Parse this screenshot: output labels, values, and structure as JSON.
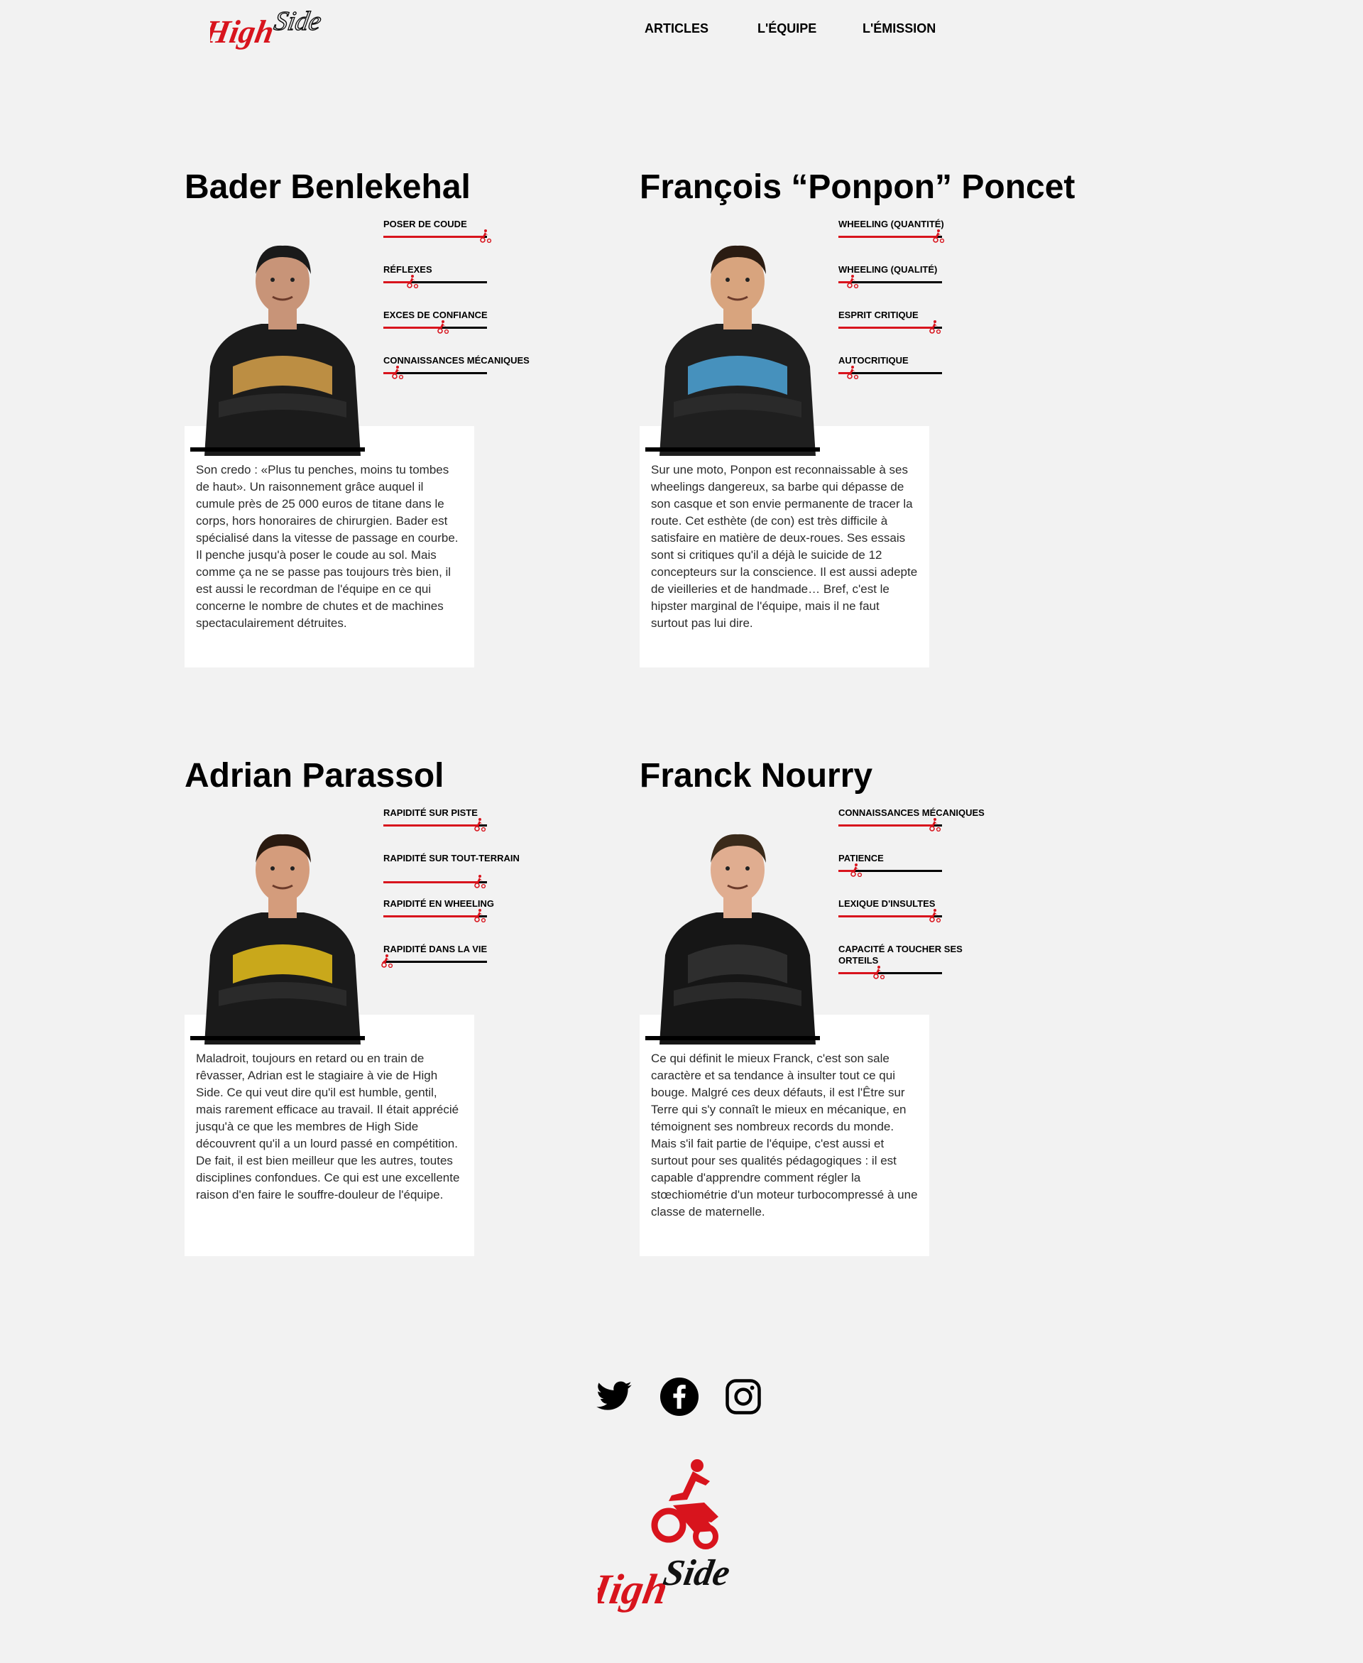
{
  "header": {
    "logo_text": "HighSide",
    "nav": [
      {
        "label": "ARTICLES"
      },
      {
        "label": "L'ÉQUIPE"
      },
      {
        "label": "L'ÉMISSION"
      }
    ]
  },
  "team": [
    {
      "name": "Bader Benlekehal",
      "skills": [
        {
          "label": "POSER DE COUDE",
          "level": 0.97
        },
        {
          "label": "RÉFLEXES",
          "level": 0.27
        },
        {
          "label": "EXCES DE CONFIANCE",
          "level": 0.56
        },
        {
          "label": "CONNAISSANCES MÉCANIQUES",
          "level": 0.12
        }
      ],
      "bio": "Son credo : «Plus tu penches, moins tu tombes de haut». Un raisonnement grâce auquel il cumule près de 25 000 euros de titane dans le corps, hors honoraires de chirurgien. Bader est spécialisé dans la vitesse de passage en courbe. Il penche jusqu'à poser le coude au sol. Mais comme ça ne se passe pas toujours très bien, il est aussi le recordman de l'équipe en ce qui concerne le nombre de chutes et de machines spectaculairement détruites."
    },
    {
      "name": "François “Ponpon” Poncet",
      "skills": [
        {
          "label": "WHEELING (QUANTITÉ)",
          "level": 0.95
        },
        {
          "label": "WHEELING (QUALITÉ)",
          "level": 0.12
        },
        {
          "label": "ESPRIT CRITIQUE",
          "level": 0.92
        },
        {
          "label": "AUTOCRITIQUE",
          "level": 0.12
        }
      ],
      "bio": "Sur une moto, Ponpon est reconnaissable à ses wheelings dangereux, sa barbe qui dépasse de son casque et son envie permanente de tracer la route. Cet esthète (de con) est très difficile à satisfaire en matière de deux-roues. Ses essais sont si critiques qu'il a déjà le suicide de 12 concepteurs sur la conscience. Il est aussi adepte de vieilleries et de handmade… Bref, c'est le hipster marginal de l'équipe, mais il ne faut surtout pas lui dire."
    },
    {
      "name": "Adrian Parassol",
      "skills": [
        {
          "label": "RAPIDITÉ SUR PISTE",
          "level": 0.92
        },
        {
          "label": "RAPIDITÉ SUR TOUT-TERRAIN",
          "level": 0.92
        },
        {
          "label": "RAPIDITÉ EN WHEELING",
          "level": 0.92
        },
        {
          "label": "RAPIDITÉ DANS LA VIE",
          "level": 0.02
        }
      ],
      "bio": "Maladroit, toujours en retard ou en train de rêvasser, Adrian est le stagiaire à vie de High Side. Ce qui veut dire qu'il est humble, gentil, mais rarement efficace au travail. Il était apprécié jusqu'à ce que les membres de High Side découvrent qu'il a un lourd passé en compétition. De fait, il est bien meilleur que les autres, toutes disciplines confondues. Ce qui est une excellente raison d'en faire le souffre-douleur de l'équipe."
    },
    {
      "name": "Franck Nourry",
      "skills": [
        {
          "label": "CONNAISSANCES MÉCANIQUES",
          "level": 0.92
        },
        {
          "label": "PATIENCE",
          "level": 0.16
        },
        {
          "label": "LEXIQUE D'INSULTES",
          "level": 0.92
        },
        {
          "label": "CAPACITÉ A TOUCHER SES ORTEILS",
          "level": 0.38
        }
      ],
      "bio": "Ce qui définit le mieux Franck, c'est son sale caractère et sa tendance à insulter tout ce qui bouge. Malgré ces deux défauts, il est l'Être sur Terre qui s'y connaît le mieux en mécanique, en témoignent ses nombreux records du monde. Mais s'il fait partie de l'équipe, c'est aussi et surtout pour ses qualités pédagogiques : il est capable d'apprendre comment régler la stœchiométrie d'un moteur turbocompressé à une classe de maternelle."
    }
  ],
  "footer": {
    "socials": [
      {
        "icon": "twitter-icon"
      },
      {
        "icon": "facebook-icon"
      },
      {
        "icon": "instagram-icon"
      }
    ],
    "logo_text": "HighSide"
  },
  "colors": {
    "accent": "#d8141d",
    "background": "#f2f2f2",
    "card": "#ffffff"
  }
}
